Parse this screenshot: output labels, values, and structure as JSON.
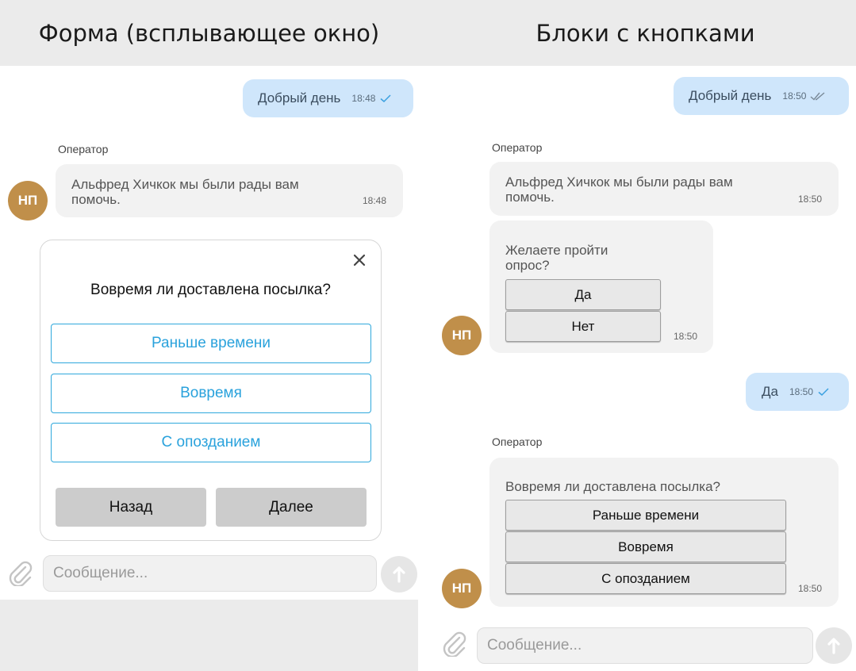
{
  "left": {
    "title": "Форма (всплывающее окно)",
    "outgoing": {
      "text": "Добрый день",
      "time": "18:48"
    },
    "operator_label": "Оператор",
    "incoming": {
      "text": "Альфред Хичкок мы были рады вам помочь.",
      "time": "18:48"
    },
    "avatar_initials": "НП",
    "modal": {
      "question": "Вовремя ли доставлена посылка?",
      "options": [
        "Раньше времени",
        "Вовремя",
        "С опозданием"
      ],
      "back_label": "Назад",
      "next_label": "Далее"
    },
    "input_placeholder": "Сообщение..."
  },
  "right": {
    "title": "Блоки с кнопками",
    "outgoing1": {
      "text": "Добрый день",
      "time": "18:50"
    },
    "operator_label1": "Оператор",
    "incoming1": {
      "text": "Альфред Хичкок мы были рады вам помочь.",
      "time": "18:50"
    },
    "survey_block": {
      "text": "Желаете пройти опрос?",
      "buttons": [
        "Да",
        "Нет"
      ],
      "time": "18:50"
    },
    "avatar_initials": "НП",
    "outgoing2": {
      "text": "Да",
      "time": "18:50"
    },
    "operator_label2": "Оператор",
    "question_block": {
      "text": "Вовремя ли доставлена посылка?",
      "buttons": [
        "Раньше времени",
        "Вовремя",
        "С опозданием"
      ],
      "time": "18:50"
    },
    "input_placeholder": "Сообщение..."
  },
  "colors": {
    "outgoing_bubble": "#cfe6fb",
    "incoming_bubble": "#f2f2f2",
    "avatar": "#c08f4a",
    "option_accent": "#2aa2dc",
    "header_bg": "#ebebeb"
  },
  "icons": [
    "check-icon",
    "double-check-icon",
    "close-icon",
    "paperclip-icon",
    "send-arrow-icon"
  ]
}
